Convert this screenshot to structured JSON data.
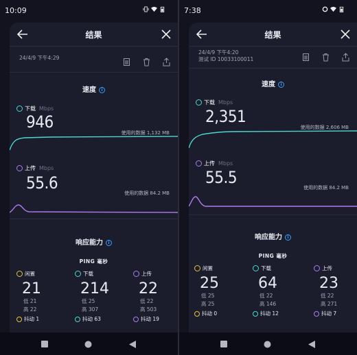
{
  "colors": {
    "download": "#4fd8d0",
    "upload": "#b07cf0",
    "ping": "#e3c447",
    "info": "#3aa0ff"
  },
  "icons": [
    "back-arrow-icon",
    "close-icon",
    "notes-icon",
    "trash-icon",
    "share-icon",
    "info-icon",
    "download-arrow-icon",
    "upload-arrow-icon",
    "ping-icon",
    "jitter-icon",
    "wifi-icon",
    "battery-icon"
  ],
  "left": {
    "status": {
      "time": "10:09"
    },
    "title": "结果",
    "meta": {
      "datetime": "24/4/9 下午4:29",
      "test_id": ""
    },
    "speed_title": "速度",
    "download": {
      "label": "下载",
      "unit": "Mbps",
      "value": "946",
      "used": "使用的数据 1,132 MB"
    },
    "upload": {
      "label": "上传",
      "unit": "Mbps",
      "value": "55.6",
      "used": "使用的数据 84.2 MB"
    },
    "response_title": "响应能力",
    "ping_header": "PING 毫秒",
    "ping_cols": [
      {
        "label": "闲置",
        "value": "21",
        "low": "低 21",
        "high": "高 22",
        "jitter": "抖动 1"
      },
      {
        "label": "下载",
        "value": "214",
        "low": "低 25",
        "high": "高 307",
        "jitter": "抖动 63"
      },
      {
        "label": "上传",
        "value": "22",
        "low": "低 22",
        "high": "高 503",
        "jitter": "抖动 19"
      }
    ]
  },
  "right": {
    "status": {
      "time": "7:38"
    },
    "title": "结果",
    "meta": {
      "datetime": "24/4/9 下午4:20",
      "test_id": "测试 ID 10033100011"
    },
    "speed_title": "速度",
    "download": {
      "label": "下载",
      "unit": "Mbps",
      "value": "2,351",
      "used": "使用的数据 2,606 MB"
    },
    "upload": {
      "label": "上传",
      "unit": "Mbps",
      "value": "55.5",
      "used": "使用的数据 84.2 MB"
    },
    "response_title": "响应能力",
    "ping_header": "PING 毫秒",
    "ping_cols": [
      {
        "label": "闲置",
        "value": "25",
        "low": "低 25",
        "high": "高 25",
        "jitter": "抖动 0"
      },
      {
        "label": "下载",
        "value": "64",
        "low": "低 22",
        "high": "高 146",
        "jitter": "抖动 12"
      },
      {
        "label": "上传",
        "value": "23",
        "low": "低 22",
        "high": "高 271",
        "jitter": "抖动 7"
      }
    ]
  }
}
